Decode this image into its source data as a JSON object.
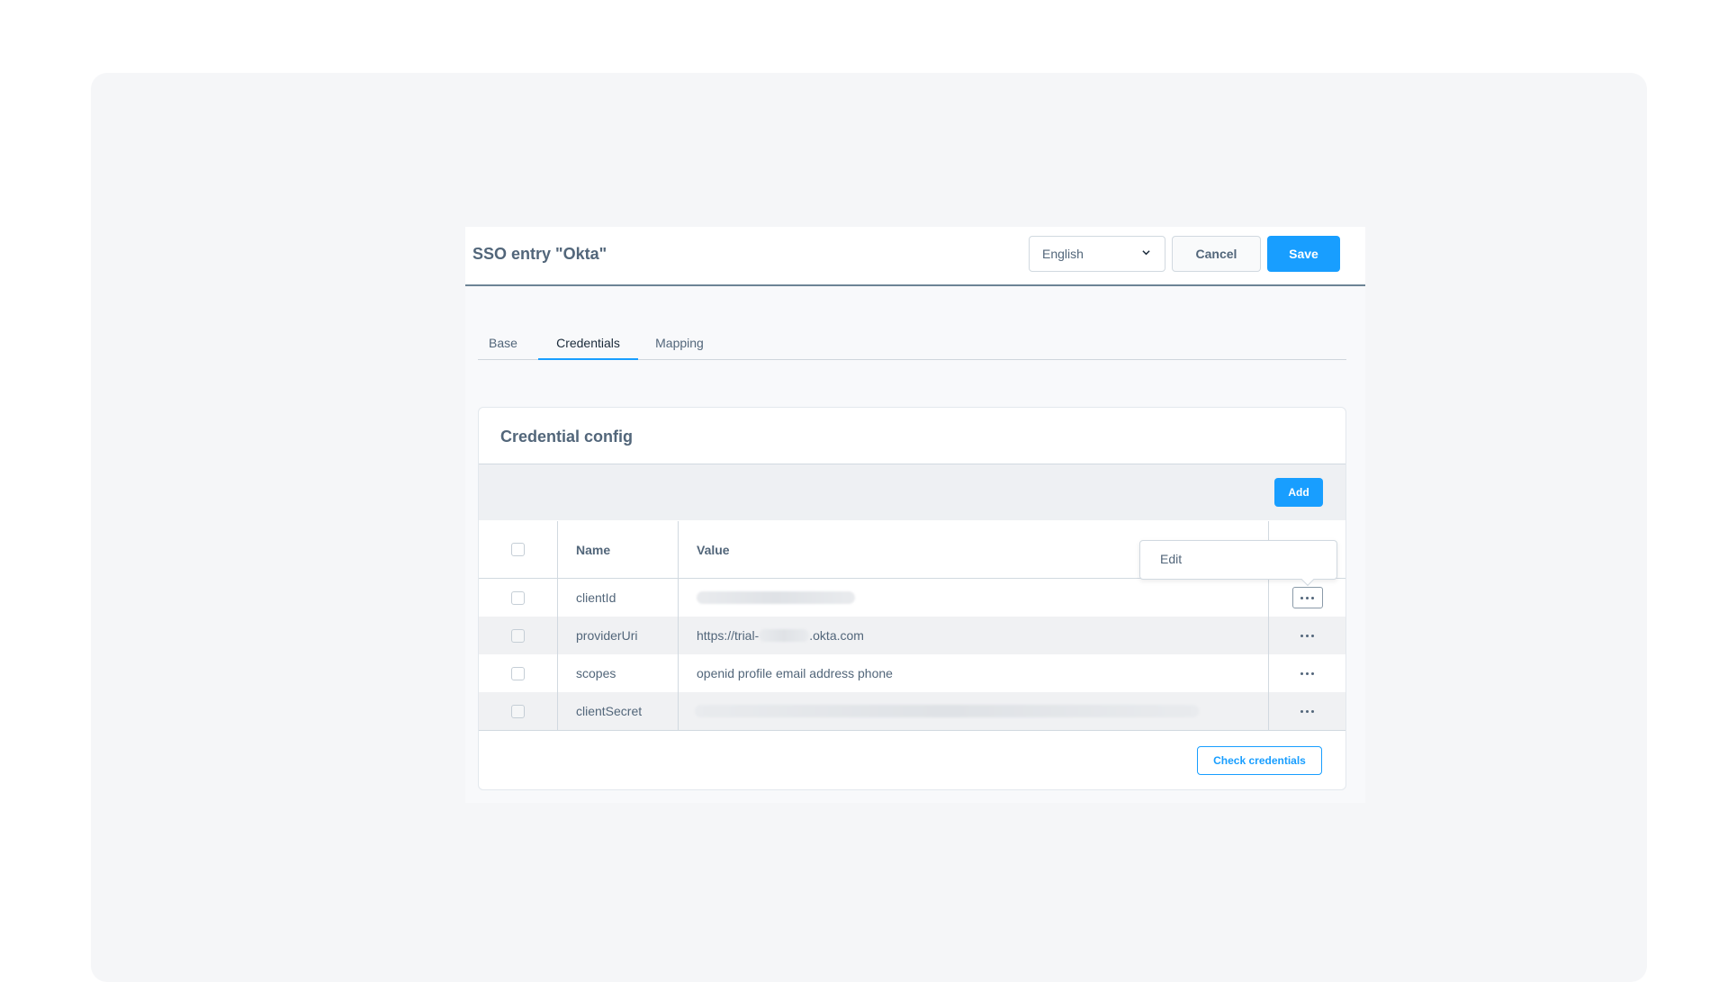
{
  "header": {
    "title": "SSO entry \"Okta\"",
    "language": "English",
    "cancel_label": "Cancel",
    "save_label": "Save"
  },
  "tabs": [
    {
      "label": "Base",
      "active": false
    },
    {
      "label": "Credentials",
      "active": true
    },
    {
      "label": "Mapping",
      "active": false
    }
  ],
  "card": {
    "title": "Credential config",
    "add_label": "Add",
    "columns": [
      "Name",
      "Value"
    ],
    "rows": [
      {
        "name": "clientId",
        "value": "",
        "value_blurred": true
      },
      {
        "name": "providerUri",
        "value_prefix": "https://trial-",
        "value_suffix": ".okta.com",
        "value_blurred": "partial"
      },
      {
        "name": "scopes",
        "value": "openid profile email address phone",
        "value_blurred": false
      },
      {
        "name": "clientSecret",
        "value": "",
        "value_blurred": true
      }
    ],
    "context_menu": {
      "item": "Edit"
    },
    "check_label": "Check credentials"
  },
  "colors": {
    "accent": "#189eff",
    "text": "#52667a",
    "backdrop": "#f5f6f8"
  },
  "icons": {
    "language_chevron": "chevron-down-icon",
    "row_actions": "more-horizontal-icon"
  }
}
